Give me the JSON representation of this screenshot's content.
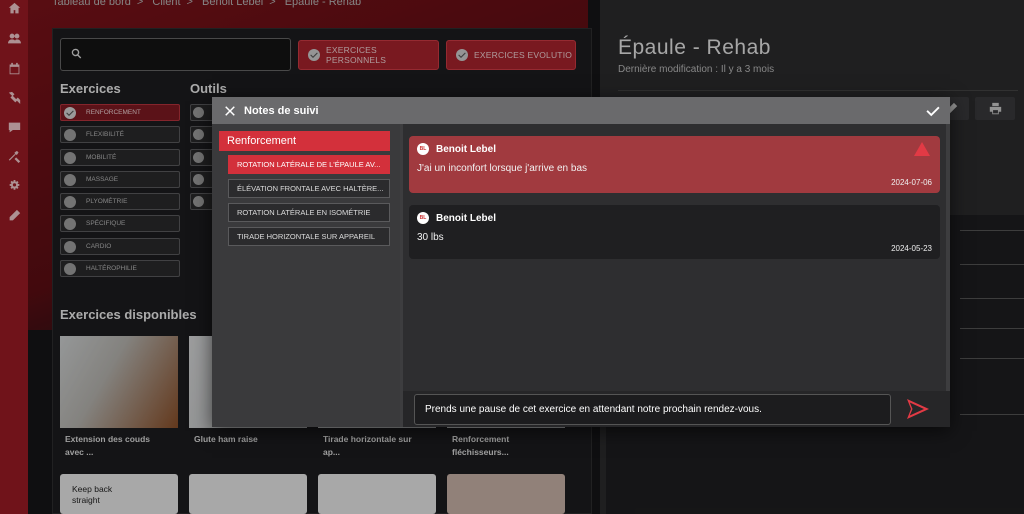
{
  "breadcrumb": [
    "Tableau de bord",
    "Client",
    "Benoit Lebel",
    "Épaule - Rehab"
  ],
  "left": {
    "search_placeholder": "",
    "btn_personal": "EXERCICES PERSONNELS",
    "btn_evolutio": "EXERCICES EVOLUTIO",
    "exercises_title": "Exercices",
    "tools_title": "Outils",
    "categories": [
      "RENFORCEMENT",
      "FLEXIBILITÉ",
      "MOBILITÉ",
      "MASSAGE",
      "PLYOMÉTRIE",
      "SPÉCIFIQUE",
      "CARDIO",
      "HALTÉROPHILIE"
    ],
    "available_title": "Exercices disponibles",
    "cards": [
      {
        "line1": "Extension des couds",
        "line2": "avec ..."
      },
      {
        "line1": "Glute ham raise",
        "line2": ""
      },
      {
        "line1": "Tirade horizontale sur",
        "line2": "ap..."
      },
      {
        "line1": "Renforcement",
        "line2": "fléchisseurs..."
      }
    ],
    "keep_back": [
      "Keep back",
      "straight"
    ]
  },
  "right": {
    "title": "Épaule - Rehab",
    "subtitle": "Dernière modification : Il y a 3 mois"
  },
  "modal": {
    "title": "Notes de suivi",
    "group": "Renforcement",
    "items": [
      "ROTATION LATÉRALE DE L'ÉPAULE AV...",
      "ÉLÉVATION FRONTALE AVEC HALTÈRE...",
      "ROTATION LATÉRALE EN ISOMÉTRIE",
      "TIRADE HORIZONTALE SUR APPAREIL"
    ],
    "notes": [
      {
        "author": "Benoit Lebel",
        "text": "J'ai un inconfort lorsque j'arrive en bas",
        "date": "2024-07-06",
        "avatar": "BL"
      },
      {
        "author": "Benoit Lebel",
        "text": "30 lbs",
        "date": "2024-05-23",
        "avatar": "BL"
      }
    ],
    "reply_value": "Prends une pause de cet exercice en attendant notre prochain rendez-vous."
  },
  "colors": {
    "accent": "#d3303b",
    "rail": "#9b1b25",
    "note_alert": "#a13a3f"
  }
}
